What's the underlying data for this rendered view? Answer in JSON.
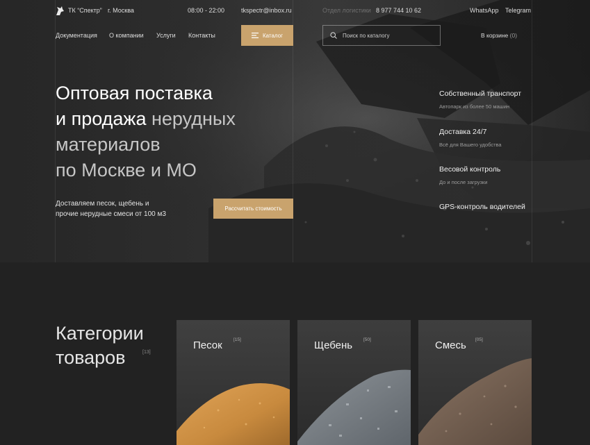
{
  "topbar": {
    "company": "ТК “Спектр”",
    "city": "г. Москва",
    "hours": "08:00 - 22:00",
    "email": "tkspectr@inbox.ru",
    "logistics_label": "Отдел логистики",
    "phone": "8 977 744 10 62",
    "whatsapp": "WhatsApp",
    "telegram": "Telegram"
  },
  "nav": {
    "items": [
      "Документация",
      "О компании",
      "Услуги",
      "Контакты"
    ],
    "catalog_label": "Каталог",
    "search_placeholder": "Поиск по каталогу",
    "cart_label": "В корзине",
    "cart_count": "(0)"
  },
  "hero": {
    "title_line1": "Оптовая поставка",
    "title_line2_white": "и продажа ",
    "title_line2_gray": "нерудных",
    "title_line3": "материалов",
    "title_line4": "по Москве и МО",
    "subtitle_line1": "Доставляем песок, щебень и",
    "subtitle_line2": "прочие нерудные смеси от 100 м3",
    "cta_label": "Рассчитать стоимость"
  },
  "features": [
    {
      "title": "Собственный транспорт",
      "desc": "Автопарк из более 50 машин"
    },
    {
      "title": "Доставка 24/7",
      "desc": "Всё для Вашего удобства"
    },
    {
      "title": "Весовой контроль",
      "desc": "До и после загрузки"
    },
    {
      "title": "GPS-контроль водителей",
      "desc": ""
    }
  ],
  "categories": {
    "heading_line1": "Категории",
    "heading_line2": "товаров",
    "count": "[13]",
    "cards": [
      {
        "name": "Песок",
        "count": "[15]"
      },
      {
        "name": "Щебень",
        "count": "[50]"
      },
      {
        "name": "Смесь",
        "count": "[05]"
      }
    ]
  },
  "colors": {
    "accent": "#c9a36d",
    "background": "#222222"
  },
  "icons": {
    "logo": "logo-mark-icon",
    "catalog": "menu-lines-icon",
    "search": "search-icon"
  }
}
